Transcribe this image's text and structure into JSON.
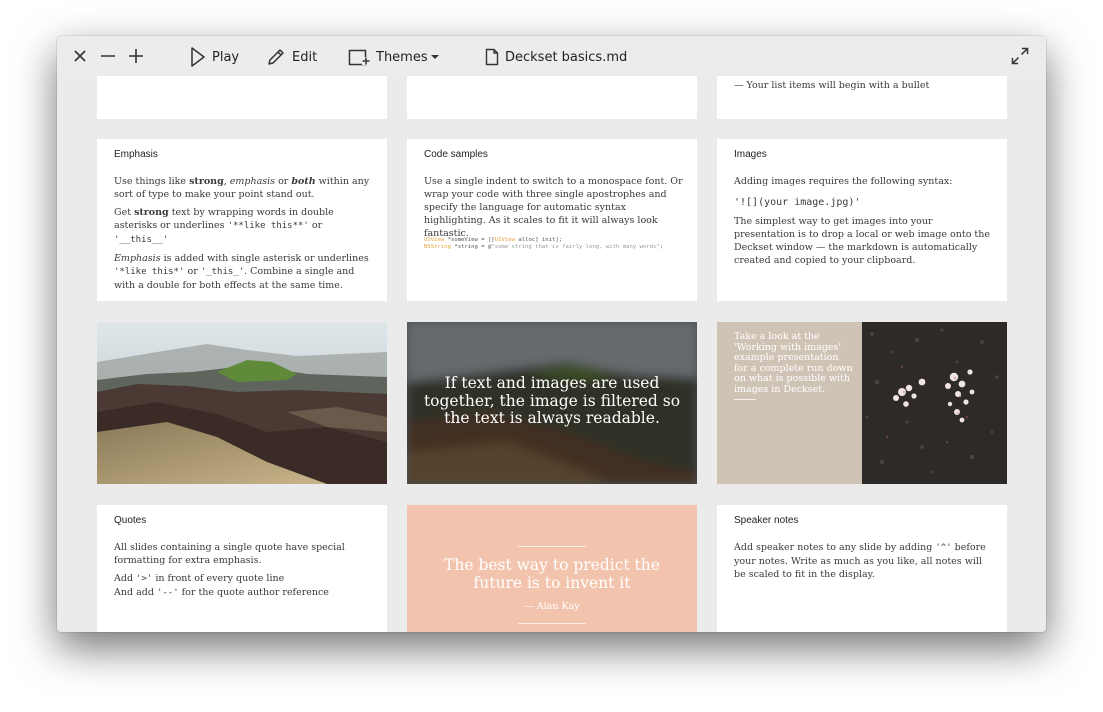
{
  "toolbar": {
    "play_label": "Play",
    "edit_label": "Edit",
    "themes_label": "Themes",
    "document_title": "Deckset basics.md"
  },
  "top_row": {
    "lists_bullet_text": "— Your list items will begin with a bullet"
  },
  "emphasis": {
    "title": "Emphasis",
    "p1_a": "Use things like ",
    "p1_strong": "strong",
    "p1_b": ", ",
    "p1_em": "emphasis",
    "p1_c": " or ",
    "p1_both": "both",
    "p1_d": " within any sort of type to make your point stand out.",
    "p2_a": "Get ",
    "p2_strong": "strong",
    "p2_b": " text by wrapping words in double asterisks or underlines ",
    "p2_code1": "'**like this**'",
    "p2_c": " or ",
    "p2_code2": "'__this__'",
    "p3_em": "Emphasis",
    "p3_a": " is added with single asterisk or underlines ",
    "p3_code1": "'*like this*'",
    "p3_b": " or ",
    "p3_code2": "'_this_'",
    "p3_c": ". Combine a single and with a double for both effects at the same time."
  },
  "code_samples": {
    "title": "Code samples",
    "body": "Use a single indent to switch to a monospace font. Or wrap your code with three single apostrophes and specify the language for automatic syntax highlighting. As it scales to fit it will always look fantastic.",
    "line1_type": "UIView",
    "line1_rest": " *someView = [[",
    "line1_type2": "UIView",
    "line1_end": " alloc] init];",
    "line2_type": "NSString",
    "line2_rest": " *string = @",
    "line2_str": "\"some string that is fairly long, with many words\"",
    "line2_end": ";"
  },
  "images": {
    "title": "Images",
    "p1": "Adding images requires the following syntax:",
    "syntax": "'![](your image.jpg)'",
    "p2": "The simplest way to get images into your presentation is to drop a local or web image onto the Deckset window — the markdown is automatically created and copied to your clipboard."
  },
  "filtered": {
    "text": "If text and images are used together, the image is filtered so the text is always readable."
  },
  "split": {
    "text": "Take a look at the 'Working with images' example presentation for a complete run down on what is possible with images in Deckset."
  },
  "quotes": {
    "title": "Quotes",
    "p1": "All slides containing a single quote have special formatting for extra emphasis.",
    "p2_a": "Add ",
    "p2_code": "'>'",
    "p2_b": " in front of every quote line",
    "p3_a": "And add ",
    "p3_code": "'--'",
    "p3_b": " for the quote author reference"
  },
  "quote_slide": {
    "quote": "The best way to predict the future is to invent it",
    "author": "— Alan Kay"
  },
  "speaker_notes": {
    "title": "Speaker notes",
    "p1_a": "Add speaker notes to any slide by adding ",
    "p1_code": "'^'",
    "p1_b": " before your notes. Write as much as you like, all notes will be scaled to fit in the display."
  },
  "colors": {
    "window_bg": "#ebebeb",
    "quote_bg": "#f2c4ae",
    "split_bg": "#cfc3b5",
    "code_keyword": "#e8a33c"
  }
}
